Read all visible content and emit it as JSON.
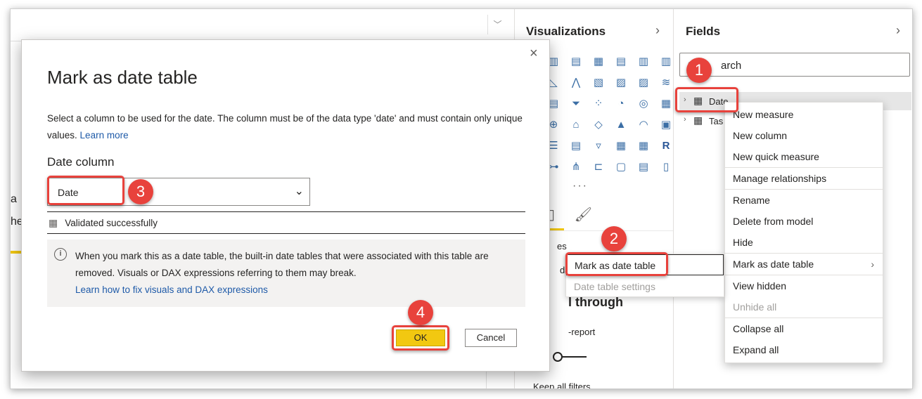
{
  "viz_pane": {
    "title": "Visualizations",
    "collapse_glyph": "›",
    "icon_grid": [
      "stacked-bar-chart-icon",
      "stacked-column-chart-icon",
      "clustered-bar-chart-icon",
      "clustered-column-chart-icon",
      "100-bar-chart-icon",
      "100-column-chart-icon",
      "line-chart-icon",
      "area-chart-icon",
      "stacked-area-chart-icon",
      "line-column-chart-icon",
      "line-clustered-column-chart-icon",
      "ribbon-chart-icon",
      "waterfall-chart-icon",
      "funnel-chart-icon",
      "scatter-chart-icon",
      "pie-chart-icon",
      "donut-chart-icon",
      "treemap-icon",
      "map-icon",
      "filled-map-icon",
      "shape-map-icon",
      "azure-map-icon",
      "gauge-icon",
      "card-icon",
      "multi-row-card-icon",
      "kpi-icon",
      "slicer-icon",
      "table-icon",
      "matrix-icon",
      "r-visual-icon",
      "python-visual-icon",
      "key-influencers-icon",
      "decomposition-tree-icon",
      "qa-icon",
      "smart-narrative-icon",
      "paginated-report-icon"
    ],
    "r_label": "R",
    "more_glyph": "···",
    "partial_values": "es",
    "partial_dat": "dat",
    "drill_through": "l through",
    "cross_report": "-report",
    "keep_all_filters": "Keep all filters"
  },
  "canvas": {
    "partial_a": "a",
    "partial_he": "he"
  },
  "fields_pane": {
    "title": "Fields",
    "collapse_glyph": "›",
    "search_text": "arch",
    "tables": [
      {
        "chevron": "›",
        "label": "Date"
      },
      {
        "chevron": "›",
        "label": "Tas"
      }
    ]
  },
  "context_menu": {
    "items": [
      {
        "label": "New measure",
        "disabled": false
      },
      {
        "label": "New column",
        "disabled": false
      },
      {
        "label": "New quick measure",
        "disabled": false
      },
      {
        "label": "Manage relationships",
        "disabled": false
      },
      {
        "label": "Rename",
        "disabled": false
      },
      {
        "label": "Delete from model",
        "disabled": false
      },
      {
        "label": "Hide",
        "disabled": false
      },
      {
        "label": "Mark as date table",
        "disabled": false,
        "submenu_glyph": "›"
      },
      {
        "label": "View hidden",
        "disabled": false
      },
      {
        "label": "Unhide all",
        "disabled": true
      },
      {
        "label": "Collapse all",
        "disabled": false
      },
      {
        "label": "Expand all",
        "disabled": false
      }
    ]
  },
  "submenu": {
    "mark": "Mark as date table",
    "settings": "Date table settings"
  },
  "dialog": {
    "close_glyph": "×",
    "title": "Mark as date table",
    "description": "Select a column to be used for the date. The column must be of the data type 'date' and must contain only unique values.",
    "learn_more": "Learn more",
    "date_column_label": "Date column",
    "selected_column": "Date",
    "validation": "Validated successfully",
    "info_text": "When you mark this as a date table, the built-in date tables that were associated with this table are removed. Visuals or DAX expressions referring to them may break.",
    "info_link": "Learn how to fix visuals and DAX expressions",
    "ok_label": "OK",
    "cancel_label": "Cancel"
  },
  "annotations": {
    "steps": [
      "1",
      "2",
      "3",
      "4"
    ],
    "highlight_color": "#e8423c"
  }
}
